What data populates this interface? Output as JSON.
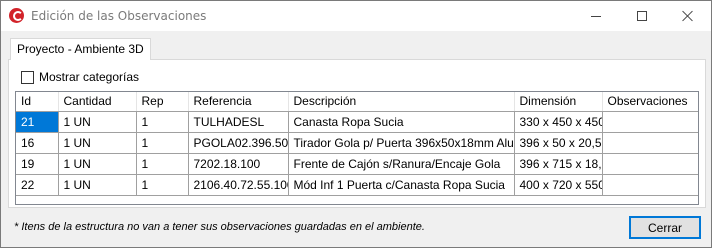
{
  "window": {
    "title": "Edición de las Observaciones",
    "accent_color": "#0078d7",
    "icon": "app-logo-icon"
  },
  "tab": {
    "label": "Proyecto - Ambiente 3D"
  },
  "show_categories": {
    "label": "Mostrar categorías",
    "checked": false
  },
  "table": {
    "columns": [
      "Id",
      "Cantidad",
      "Rep",
      "Referencia",
      "Descripción",
      "Dimensión",
      "Observaciones"
    ],
    "rows": [
      [
        "21",
        "1 UN",
        "1",
        "TULHADESL",
        "Canasta Ropa Sucia",
        "330 x 450 x 450",
        ""
      ],
      [
        "16",
        "1 UN",
        "1",
        "PGOLA02.396.500",
        "Tirador Gola p/ Puerta 396x50x18mm Aluminio",
        "396 x 50 x 20,5",
        ""
      ],
      [
        "19",
        "1 UN",
        "1",
        "7202.18.100",
        "Frente de Cajón s/Ranura/Encaje Gola",
        "396 x 715 x 18,5",
        ""
      ],
      [
        "22",
        "1 UN",
        "1",
        "2106.40.72.55.100",
        "Mód Inf 1 Puerta c/Canasta Ropa Sucia",
        "400 x 720 x 550",
        ""
      ]
    ],
    "selected_cell": "row 1, Id"
  },
  "footnote": "* Itens de la estructura no van a tener sus observaciones guardadas en el ambiente.",
  "close_button": {
    "label": "Cerrar"
  }
}
